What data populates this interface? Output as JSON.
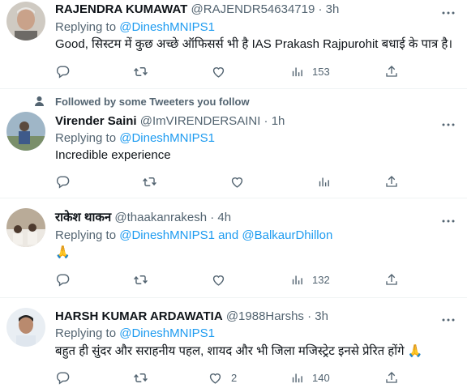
{
  "tweets": [
    {
      "name": "RAJENDRA KUMAWAT",
      "handle": "@RAJENDR54634719",
      "dot": "·",
      "time": "3h",
      "replying_prefix": "Replying to ",
      "replying_to": "@DineshMNIPS1",
      "text": "Good, सिस्टम में कुछ अच्छे ऑफिसर्स भी है IAS Prakash Rajpurohit बधाई के पात्र है।",
      "views": "153",
      "likes": ""
    },
    {
      "followed_label": "Followed by some Tweeters you follow",
      "name": "Virender Saini",
      "handle": "@ImVIRENDERSAINI",
      "dot": "·",
      "time": "1h",
      "replying_prefix": "Replying to ",
      "replying_to": "@DineshMNIPS1",
      "text": "Incredible experience"
    },
    {
      "name": "राकेश थाकन",
      "handle": "@thaakanrakesh",
      "dot": "·",
      "time": "4h",
      "replying_prefix": "Replying to ",
      "replying_to": "@DineshMNIPS1",
      "replying_and": " and ",
      "replying_to_2": "@BalkaurDhillon",
      "text": "🙏",
      "views": "132"
    },
    {
      "name": "HARSH KUMAR ARDAWATIA",
      "handle": "@1988Harshs",
      "dot": "·",
      "time": "3h",
      "replying_prefix": "Replying to ",
      "replying_to": "@DineshMNIPS1",
      "text": "बहुत ही सुंदर और सराहनीय पहल, शायद और भी जिला मजिस्ट्रेट इनसे प्रेरित होंगे 🙏",
      "likes": "2",
      "views": "140"
    }
  ],
  "colors": {
    "link": "#1d9bf0",
    "muted": "#536471",
    "text": "#0f1419"
  },
  "icons": [
    "more-icon",
    "reply-icon",
    "retweet-icon",
    "like-icon",
    "views-icon",
    "share-icon",
    "person-icon"
  ]
}
